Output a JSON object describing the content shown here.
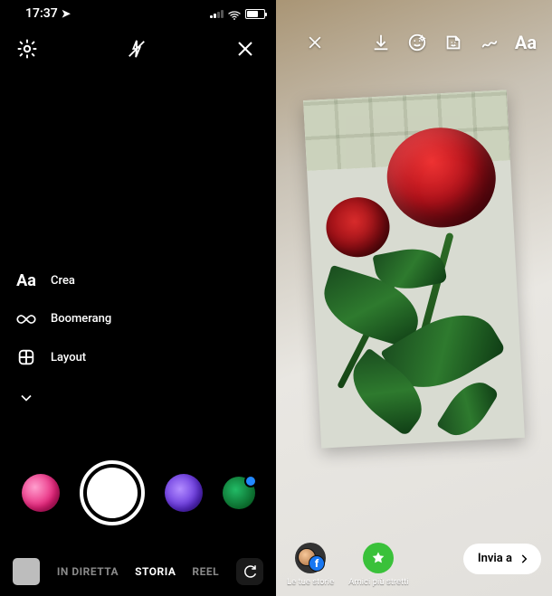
{
  "left": {
    "statusbar": {
      "time": "17:37"
    },
    "modes": {
      "crea": {
        "label": "Crea"
      },
      "boomerang": {
        "label": "Boomerang"
      },
      "layout": {
        "label": "Layout"
      }
    },
    "tabs": {
      "diretta": "IN DIRETTA",
      "storia": "STORIA",
      "reel": "REEL"
    }
  },
  "right": {
    "toolbar": {
      "text_tool": "Aa"
    },
    "destinations": {
      "your_stories": {
        "label": "Le tue storie",
        "fb_glyph": "f"
      },
      "close_friends": {
        "label": "Amici più stretti"
      }
    },
    "send": {
      "label": "Invia a"
    }
  }
}
